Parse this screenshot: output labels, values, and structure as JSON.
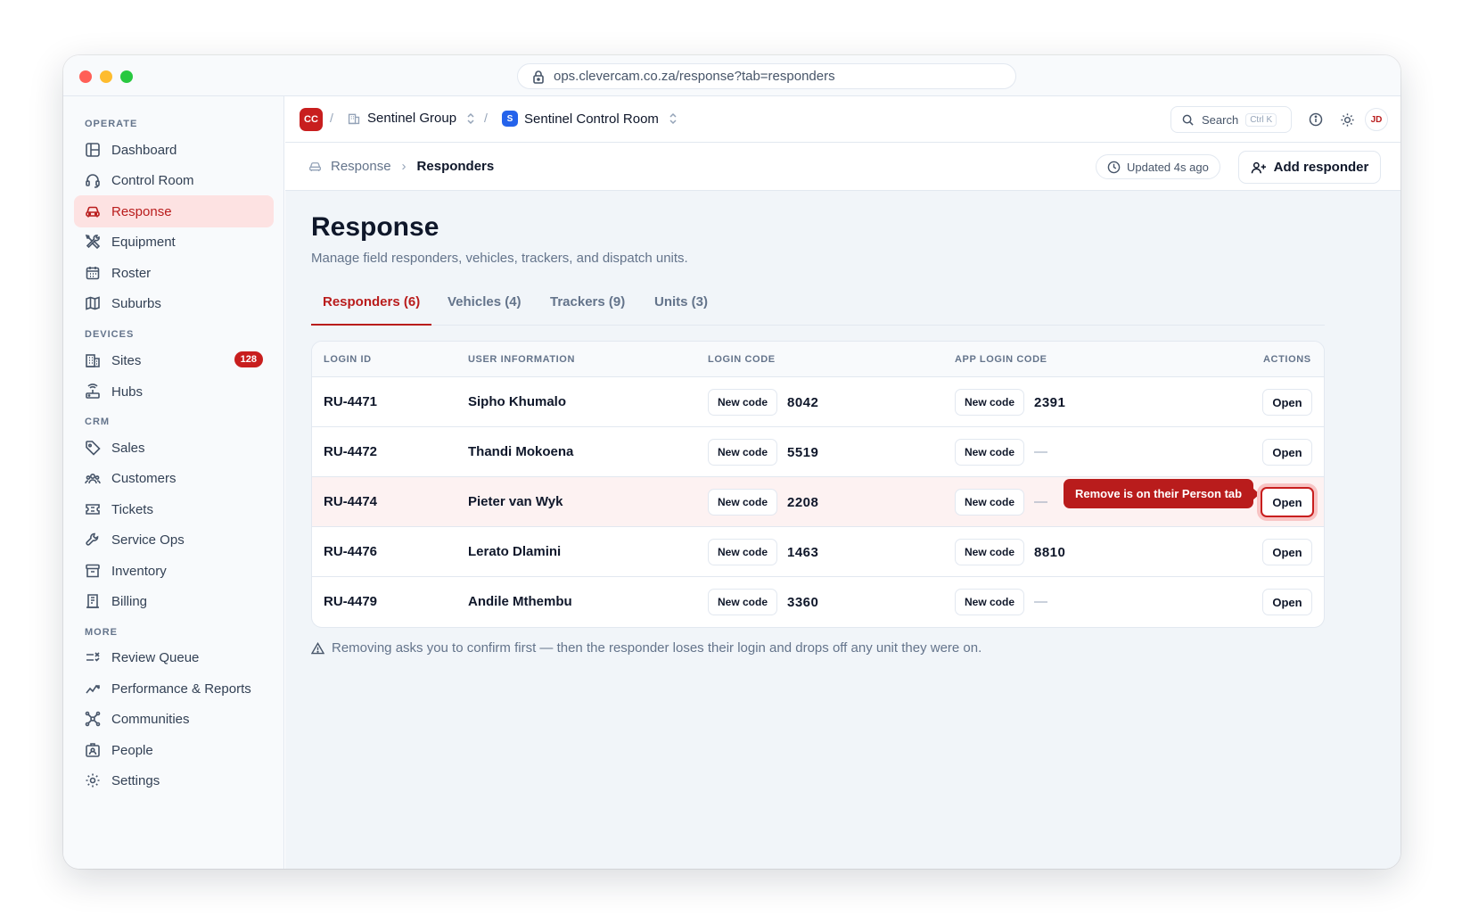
{
  "browser": {
    "url": "ops.clevercam.co.za/response?tab=responders"
  },
  "sidebar": {
    "sections": {
      "operate": "OPERATE",
      "devices": "DEVICES",
      "crm": "CRM",
      "more": "MORE"
    },
    "items": [
      {
        "label": "Dashboard",
        "icon": "dashboard-icon"
      },
      {
        "label": "Control Room",
        "icon": "headset-icon"
      },
      {
        "label": "Response",
        "icon": "car-icon",
        "active": true
      },
      {
        "label": "Equipment",
        "icon": "tools-icon"
      },
      {
        "label": "Roster",
        "icon": "calendar-icon"
      },
      {
        "label": "Suburbs",
        "icon": "map-icon"
      },
      {
        "label": "Sites",
        "icon": "building-icon",
        "badge": "128"
      },
      {
        "label": "Hubs",
        "icon": "router-icon"
      },
      {
        "label": "Sales",
        "icon": "tag-icon"
      },
      {
        "label": "Customers",
        "icon": "users-icon"
      },
      {
        "label": "Tickets",
        "icon": "ticket-icon"
      },
      {
        "label": "Service Ops",
        "icon": "wrench-icon"
      },
      {
        "label": "Inventory",
        "icon": "archive-icon"
      },
      {
        "label": "Billing",
        "icon": "receipt-icon"
      },
      {
        "label": "Review Queue",
        "icon": "list-check-icon"
      },
      {
        "label": "Performance & Reports",
        "icon": "chart-line-icon"
      },
      {
        "label": "Communities",
        "icon": "network-icon"
      },
      {
        "label": "People",
        "icon": "id-badge-icon"
      },
      {
        "label": "Settings",
        "icon": "gear-icon"
      }
    ]
  },
  "topbar": {
    "org_logo": "CC",
    "org_name": "Sentinel Group",
    "room_badge": "S",
    "room_name": "Sentinel Control Room",
    "search_label": "Search",
    "search_shortcut": "Ctrl K",
    "avatar": "JD"
  },
  "header": {
    "breadcrumb_parent": "Response",
    "breadcrumb_current": "Responders",
    "updated": "Updated 4s ago",
    "add_button": "Add responder"
  },
  "page": {
    "title": "Response",
    "subtitle": "Manage field responders, vehicles, trackers, and dispatch units.",
    "tabs": [
      {
        "label": "Responders (6)",
        "active": true
      },
      {
        "label": "Vehicles (4)"
      },
      {
        "label": "Trackers (9)"
      },
      {
        "label": "Units (3)"
      }
    ]
  },
  "table": {
    "columns": [
      "LOGIN ID",
      "USER INFORMATION",
      "LOGIN CODE",
      "APP LOGIN CODE",
      "ACTIONS"
    ],
    "new_code_label": "New code",
    "open_label": "Open",
    "empty_mark": "—",
    "rows": [
      {
        "login_id": "RU-4471",
        "name": "Sipho Khumalo",
        "login_code": "8042",
        "app_code": "2391"
      },
      {
        "login_id": "RU-4472",
        "name": "Thandi Mokoena",
        "login_code": "5519",
        "app_code": ""
      },
      {
        "login_id": "RU-4474",
        "name": "Pieter van Wyk",
        "login_code": "2208",
        "app_code": "",
        "highlight": true
      },
      {
        "login_id": "RU-4476",
        "name": "Lerato Dlamini",
        "login_code": "1463",
        "app_code": "8810"
      },
      {
        "login_id": "RU-4479",
        "name": "Andile Mthembu",
        "login_code": "3360",
        "app_code": ""
      }
    ]
  },
  "tooltip": "Remove is on their Person tab",
  "footnote": "Removing asks you to confirm first — then the responder loses their login and drops off any unit they were on.",
  "colors": {
    "accent": "#b91c1c",
    "badge": "#c81e1e",
    "room": "#2563eb"
  }
}
